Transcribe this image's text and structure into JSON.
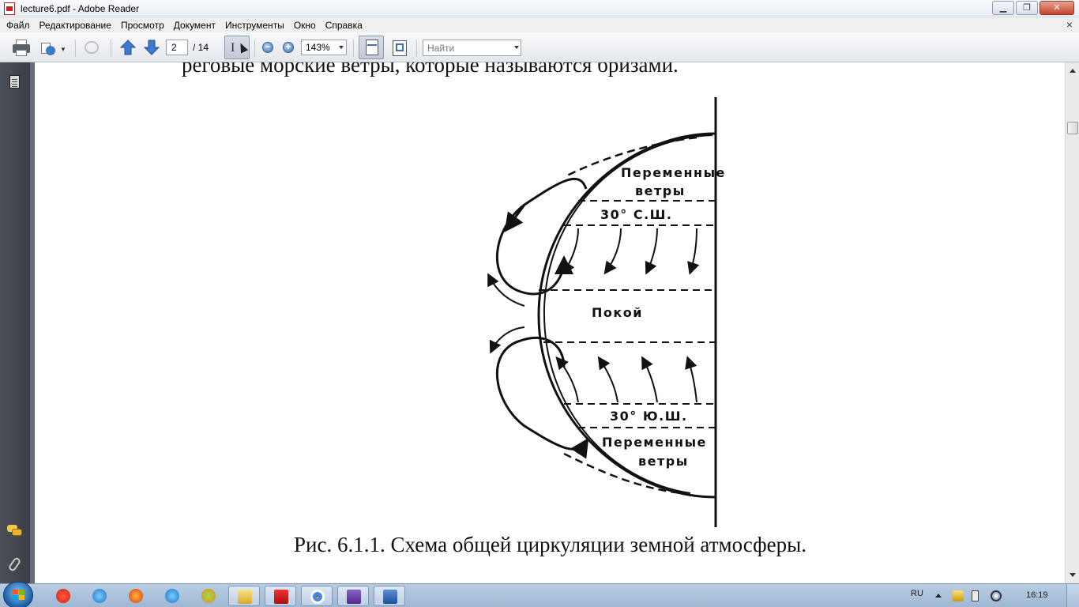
{
  "window": {
    "title": "lecture6.pdf - Adobe Reader"
  },
  "menu": {
    "items": [
      "Файл",
      "Редактирование",
      "Просмотр",
      "Документ",
      "Инструменты",
      "Окно",
      "Справка"
    ]
  },
  "toolbar": {
    "page_current": "2",
    "page_total": "/ 14",
    "zoom": "143%",
    "search_placeholder": "Найти"
  },
  "document": {
    "top_text": "реговые морские ветры, которые называются бризами.",
    "caption": "Рис. 6.1.1. Схема общей циркуляции земной атмосферы.",
    "figure": {
      "label_variable_top_1": "Переменные",
      "label_variable_top_2": "ветры",
      "label_30n": "30° С.Ш.",
      "label_calm": "Покой",
      "label_30s": "30° Ю.Ш.",
      "label_variable_bottom_1": "Переменные",
      "label_variable_bottom_2": "ветры"
    }
  },
  "taskbar": {
    "language": "RU",
    "clock": "16:19"
  },
  "colors": {
    "nav_pane": "#43484e",
    "taskbar": "#a9c0d8",
    "toolbar": "#e8ebf0"
  }
}
